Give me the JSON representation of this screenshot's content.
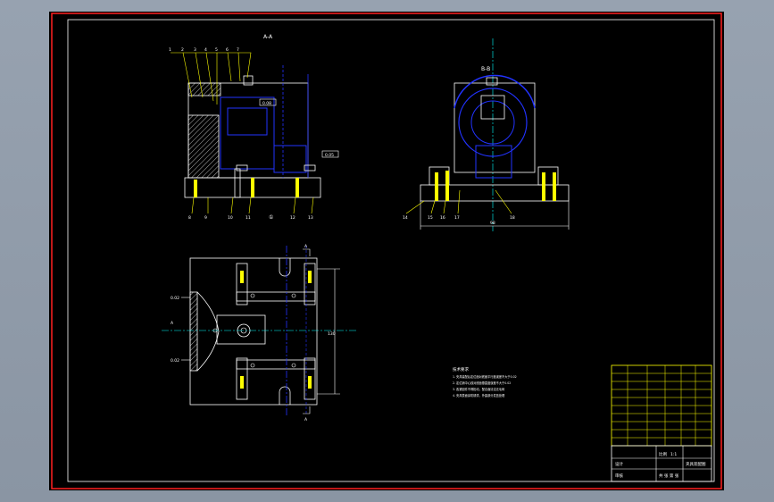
{
  "sheet": {
    "colors": {
      "background": "#000000",
      "frame": "#ff2020",
      "outline": "#ffffff",
      "hidden": "#2233ff",
      "leader": "#ffff00",
      "center": "#00ffff",
      "hatch": "#ffffff",
      "part": "#ffffff"
    }
  },
  "views": {
    "front_title": "A-A",
    "side_title": "B-B",
    "section_mark_top": "A",
    "section_mark_bottom": "A",
    "side_dimension": "98",
    "plan_dimension": "130",
    "datum_symbol": "①"
  },
  "balloons_top": [
    "1",
    "2",
    "3",
    "4",
    "5",
    "6",
    "7"
  ],
  "balloons_bottom_front": [
    "8",
    "9",
    "10",
    "11",
    "12",
    "13"
  ],
  "balloons_bottom_side": [
    "14",
    "15",
    "16",
    "17",
    "18"
  ],
  "callouts": {
    "front_a": "0.08",
    "front_b": "0.05",
    "plan_a": "0.02",
    "plan_b": "A",
    "plan_c": "0.02"
  },
  "tech_notes": {
    "heading": "技术要求",
    "items": [
      "1. 夹具装配后定位面对底面平行度误差不大于0.02",
      "2. 定位销中心线对底面垂直度误差不大于0.02",
      "3. 各紧固件不得松动，配合面清洁无毛刺",
      "4. 夹具表面涂防锈漆，外露部分发蓝处理"
    ]
  },
  "title_block": {
    "drawing_name": "夹具装配图",
    "scale_label": "比例",
    "scale_value": "1:1",
    "designer": "设计",
    "checker": "审核",
    "sheet_label": "共 张 第 张"
  }
}
